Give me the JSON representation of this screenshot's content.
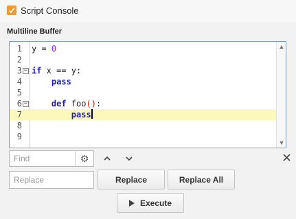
{
  "window": {
    "title": "Script Console",
    "icon": "script-console-icon"
  },
  "section": {
    "label": "Multiline Buffer"
  },
  "editor": {
    "lines": [
      {
        "num": "1",
        "code": "y = 0"
      },
      {
        "num": "2",
        "code": ""
      },
      {
        "num": "3",
        "code": "if x == y:"
      },
      {
        "num": "4",
        "code": "    pass"
      },
      {
        "num": "5",
        "code": ""
      },
      {
        "num": "6",
        "code": "    def foo():"
      },
      {
        "num": "7",
        "code": "        pass"
      },
      {
        "num": "8",
        "code": ""
      },
      {
        "num": "9",
        "code": ""
      }
    ],
    "current_line": "7",
    "colors": {
      "keyword": "#1f1fa8",
      "number": "#8a2be2",
      "paren": "#cc1111",
      "current_line_bg": "#fcf8bc"
    }
  },
  "find": {
    "placeholder": "Find"
  },
  "replace": {
    "placeholder": "Replace",
    "replace_label": "Replace",
    "replace_all_label": "Replace All"
  },
  "execute": {
    "label": "Execute"
  }
}
